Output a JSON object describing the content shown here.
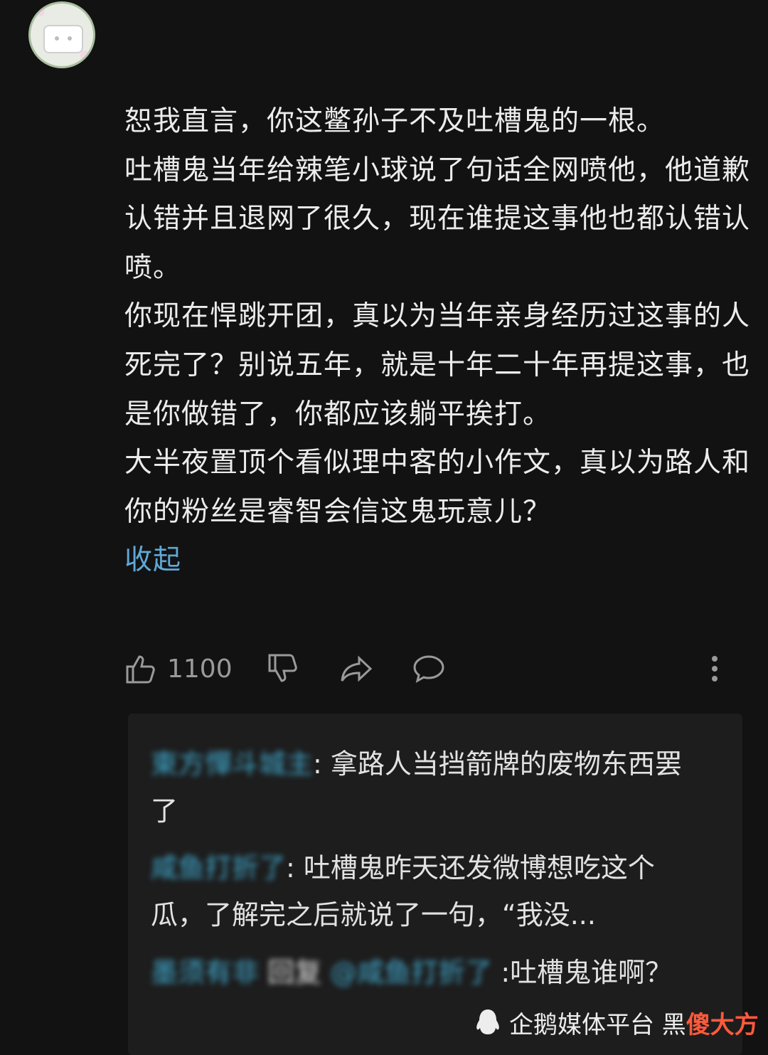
{
  "comment": {
    "paragraphs": [
      "恕我直言，你这鳖孙子不及吐槽鬼的一根。",
      "吐槽鬼当年给辣笔小球说了句话全网喷他，他道歉认错并且退网了很久，现在谁提这事他也都认错认喷。",
      "你现在悍跳开团，真以为当年亲身经历过这事的人死完了？别说五年，就是十年二十年再提这事，也是你做错了，你都应该躺平挨打。",
      "大半夜置顶个看似理中客的小作文，真以为路人和你的粉丝是睿智会信这鬼玩意儿？"
    ],
    "collapse_label": "收起"
  },
  "actions": {
    "like_count": "1100",
    "icons": [
      "thumbs-up-icon",
      "thumbs-down-icon",
      "share-icon",
      "reply-bubble-icon",
      "more-vertical-icon"
    ]
  },
  "replies": [
    {
      "user": "東方憚斗城主",
      "sep": ": ",
      "text": "拿路人当挡箭牌的废物东西罢了"
    },
    {
      "user": "咸鱼打折了",
      "sep": ": ",
      "text": "吐槽鬼昨天还发微博想吃这个瓜，了解完之后就说了一句，“我没..."
    },
    {
      "user": "墨须有非",
      "reply_word": "回复",
      "mention": "@咸鱼打折了",
      "sep": " :",
      "text": "吐槽鬼谁啊？"
    }
  ],
  "watermark": {
    "text": "企鹅媒体平台 黑",
    "badge": "傻大方"
  },
  "colors": {
    "background": "#121212",
    "link": "#5fa8d6",
    "username": "#3fa5c9",
    "reply_panel": "#1d1d1d"
  }
}
